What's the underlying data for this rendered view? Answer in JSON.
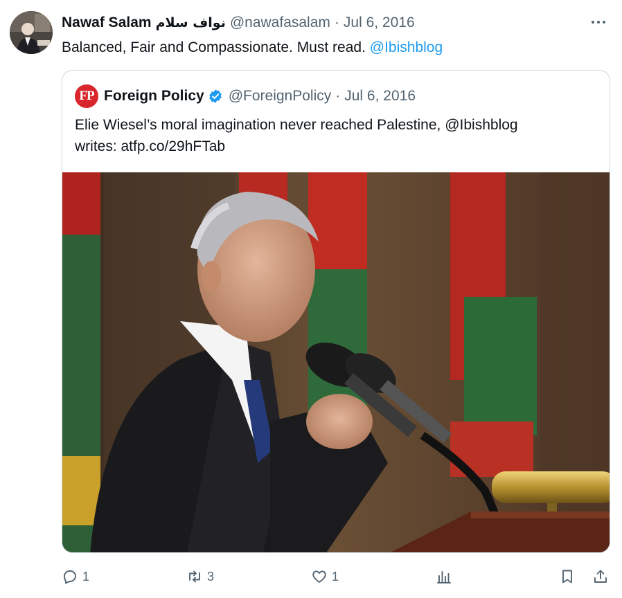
{
  "author": {
    "name": "Nawaf Salam",
    "arabic_name": "نواف سلام",
    "handle": "@nawafasalam",
    "separator": "·",
    "date": "Jul 6, 2016"
  },
  "tweet": {
    "text": "Balanced, Fair and Compassionate. Must read.",
    "mention": "@Ibishblog"
  },
  "quoted": {
    "logo_text": "FP",
    "name": "Foreign Policy",
    "verified": true,
    "handle": "@ForeignPolicy",
    "separator": "·",
    "date": "Jul 6, 2016",
    "text_line1": "Elie Wiesel’s moral imagination never reached Palestine, @Ibishblog",
    "text_line2": "writes: atfp.co/29hFTab",
    "image_subject": "Elderly man speaking at a podium microphone in front of red and green flags"
  },
  "actions": {
    "reply_count": "1",
    "retweet_count": "3",
    "like_count": "1",
    "views_count": "",
    "icons": [
      "reply-icon",
      "retweet-icon",
      "like-icon",
      "views-icon",
      "bookmark-icon",
      "share-icon"
    ]
  },
  "colors": {
    "link": "#1d9bf0",
    "muted": "#536471",
    "text": "#0f1419",
    "border": "#cfd9de",
    "fp_red": "#d9262c",
    "verified_blue": "#1d9bf0"
  }
}
